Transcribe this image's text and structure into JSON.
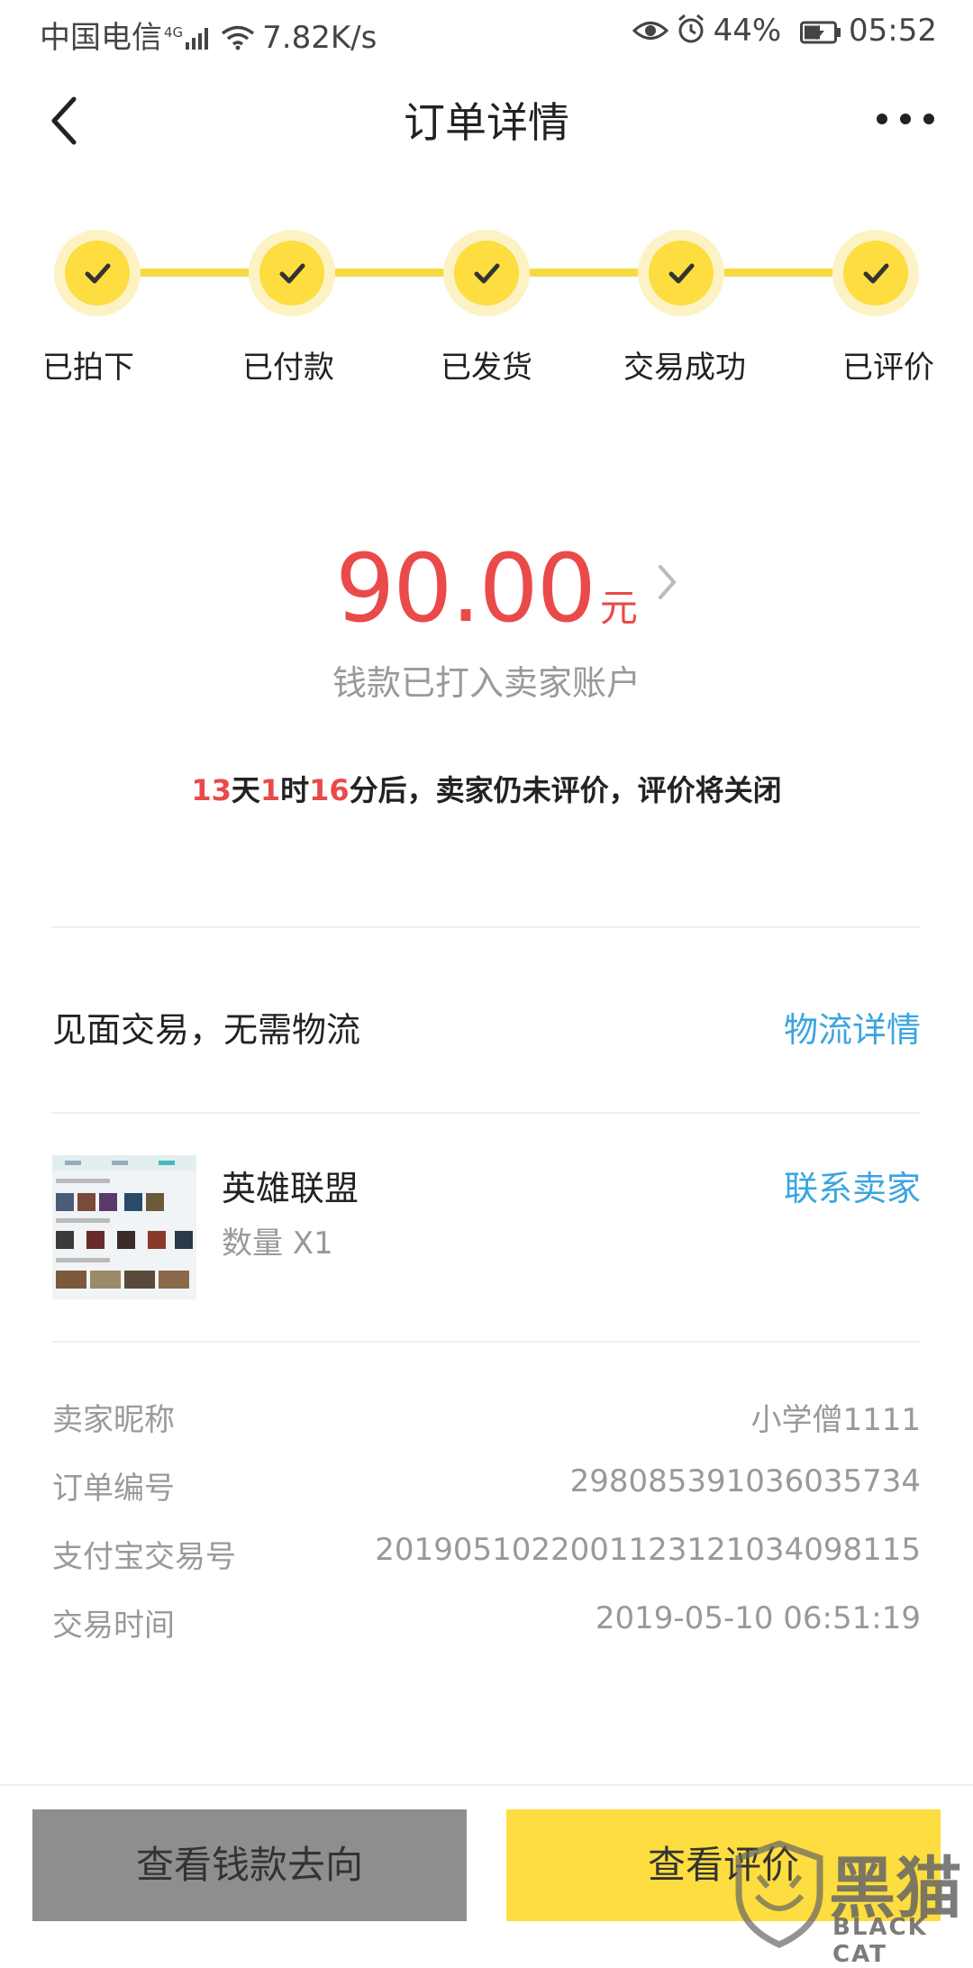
{
  "status_bar": {
    "carrier": "中国电信",
    "network": "4G",
    "speed": "7.82K/s",
    "battery": "44%",
    "time": "05:52"
  },
  "nav": {
    "title": "订单详情",
    "back_icon": "chevron-left-icon",
    "more_icon": "more-dots-icon"
  },
  "progress": {
    "steps": [
      {
        "label": "已拍下",
        "done": true
      },
      {
        "label": "已付款",
        "done": true
      },
      {
        "label": "已发货",
        "done": true
      },
      {
        "label": "交易成功",
        "done": true
      },
      {
        "label": "已评价",
        "done": true
      }
    ]
  },
  "amount": {
    "value": "90.00",
    "unit": "元",
    "desc": "钱款已打入卖家账户"
  },
  "countdown": {
    "days": "13",
    "days_unit": "天",
    "hours": "1",
    "hours_unit": "时",
    "minutes": "16",
    "suffix": "分后，卖家仍未评价，评价将关闭"
  },
  "delivery": {
    "text": "见面交易，无需物流",
    "link": "物流详情"
  },
  "product": {
    "name": "英雄联盟",
    "quantity": "数量 X1",
    "contact": "联系卖家"
  },
  "info": [
    {
      "label": "卖家昵称",
      "value": "小学僧1111"
    },
    {
      "label": "订单编号",
      "value": "2980853910360357​34"
    },
    {
      "label": "支付宝交易号",
      "value": "2019051022001123121034098115"
    },
    {
      "label": "交易时间",
      "value": "2019-05-10 06:51:19"
    }
  ],
  "buttons": {
    "money_flow": "查看钱款去向",
    "view_review": "查看评价"
  },
  "watermark": {
    "title": "黑猫",
    "sub": "BLACK CAT"
  },
  "colors": {
    "accent_yellow": "#fddd3f",
    "price_red": "#ea4a4a",
    "link_blue": "#3aa5e0"
  }
}
